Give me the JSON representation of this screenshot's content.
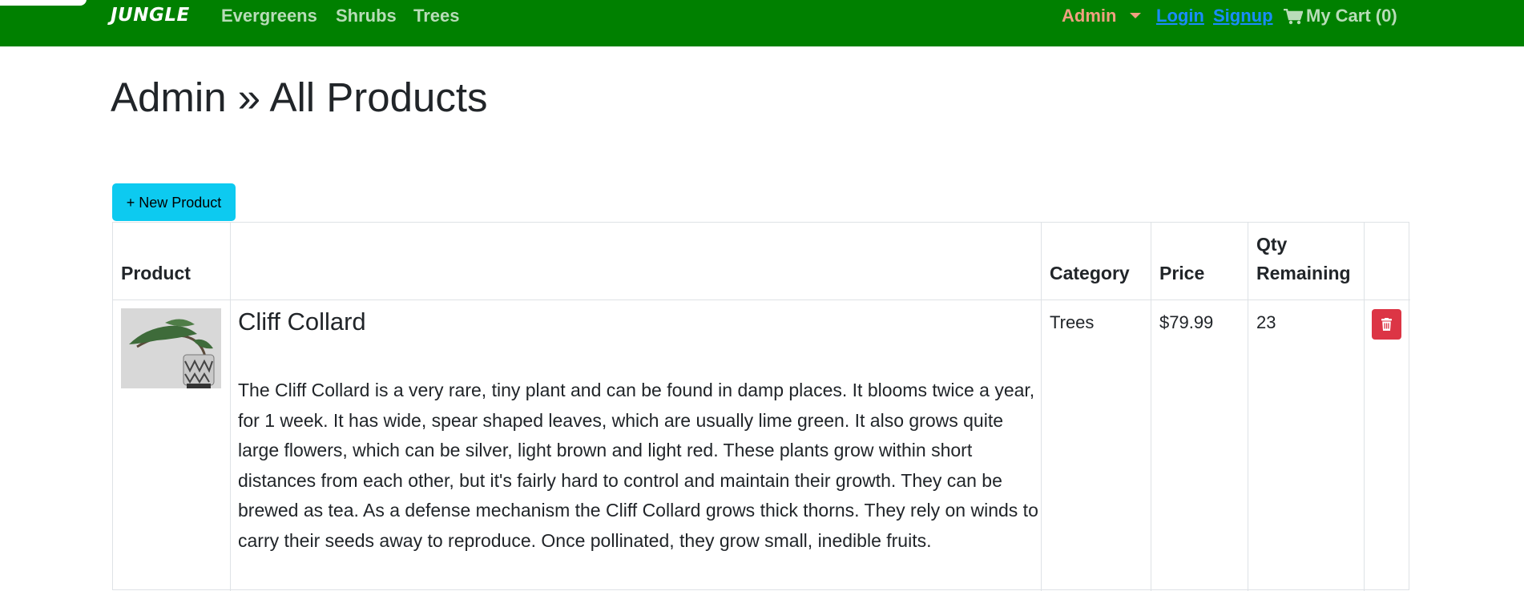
{
  "nav": {
    "brand": "JUNGLE",
    "links": [
      "Evergreens",
      "Shrubs",
      "Trees"
    ],
    "admin": "Admin",
    "login": "Login",
    "signup": "Signup",
    "cart": "My Cart (0)"
  },
  "page": {
    "title": "Admin » All Products",
    "new_product_label": "+ New Product"
  },
  "table": {
    "headers": {
      "product": "Product",
      "category": "Category",
      "price": "Price",
      "qty_line1": "Qty",
      "qty_line2": "Remaining"
    },
    "rows": [
      {
        "name": "Cliff Collard",
        "description": "The Cliff Collard is a very rare, tiny plant and can be found in damp places. It blooms twice a year, for 1 week. It has wide, spear shaped leaves, which are usually lime green. It also grows quite large flowers, which can be silver, light brown and light red. These plants grow within short distances from each other, but it's fairly hard to control and maintain their growth. They can be brewed as tea. As a defense mechanism the Cliff Collard grows thick thorns. They rely on winds to carry their seeds away to reproduce. Once pollinated, they grow small, inedible fruits.",
        "category": "Trees",
        "price": "$79.99",
        "qty": "23"
      }
    ]
  },
  "colors": {
    "navbar": "#008000",
    "admin": "#f0a080",
    "auth_link": "#1a8cff",
    "new_button": "#0dcaf0",
    "delete_button": "#dc3545"
  },
  "icons": [
    "cart-icon",
    "caret-down-icon",
    "trash-icon",
    "product-thumbnail"
  ]
}
